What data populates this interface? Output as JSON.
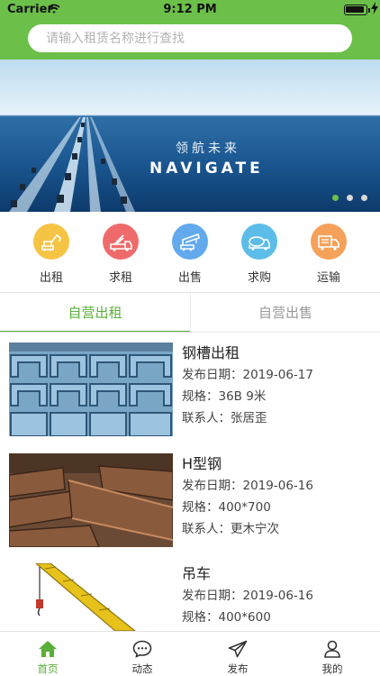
{
  "status_bar": {
    "carrier": "Carrier",
    "time": "9:12 PM"
  },
  "search": {
    "placeholder": "请输入租赁名称进行查找"
  },
  "banner": {
    "cn_text": "领航未来",
    "en_text": "NAVIGATE",
    "slide_count": 3,
    "active_slide": 1
  },
  "categories": [
    {
      "label": "出租",
      "color": "#f6c445",
      "icon": "excavator-icon"
    },
    {
      "label": "求租",
      "color": "#ef6b6b",
      "icon": "crane-truck-icon"
    },
    {
      "label": "出售",
      "color": "#62a9ee",
      "icon": "crane-icon"
    },
    {
      "label": "求购",
      "color": "#5cbde8",
      "icon": "mixer-truck-icon"
    },
    {
      "label": "运输",
      "color": "#f5a15a",
      "icon": "truck-icon"
    }
  ],
  "tabs": [
    {
      "label": "自营出租",
      "active": true
    },
    {
      "label": "自营出售",
      "active": false
    }
  ],
  "listings": [
    {
      "title": "钢槽出租",
      "date_label": "发布日期：",
      "date": "2019-06-17",
      "spec_label": "规格：",
      "spec": "36B 9米",
      "contact_label": "联系人：",
      "contact": "张居歪"
    },
    {
      "title": "H型钢",
      "date_label": "发布日期：",
      "date": "2019-06-16",
      "spec_label": "规格：",
      "spec": "400*700",
      "contact_label": "联系人：",
      "contact": "更木宁次"
    },
    {
      "title": "吊车",
      "date_label": "发布日期：",
      "date": "2019-06-16",
      "spec_label": "规格：",
      "spec": "400*600"
    }
  ],
  "tabbar": [
    {
      "label": "首页",
      "icon": "home-icon",
      "active": true
    },
    {
      "label": "动态",
      "icon": "chat-icon",
      "active": false
    },
    {
      "label": "发布",
      "icon": "send-icon",
      "active": false
    },
    {
      "label": "我的",
      "icon": "user-icon",
      "active": false
    }
  ],
  "colors": {
    "brand_green": "#6cc04a",
    "active_green": "#5aae3a"
  }
}
